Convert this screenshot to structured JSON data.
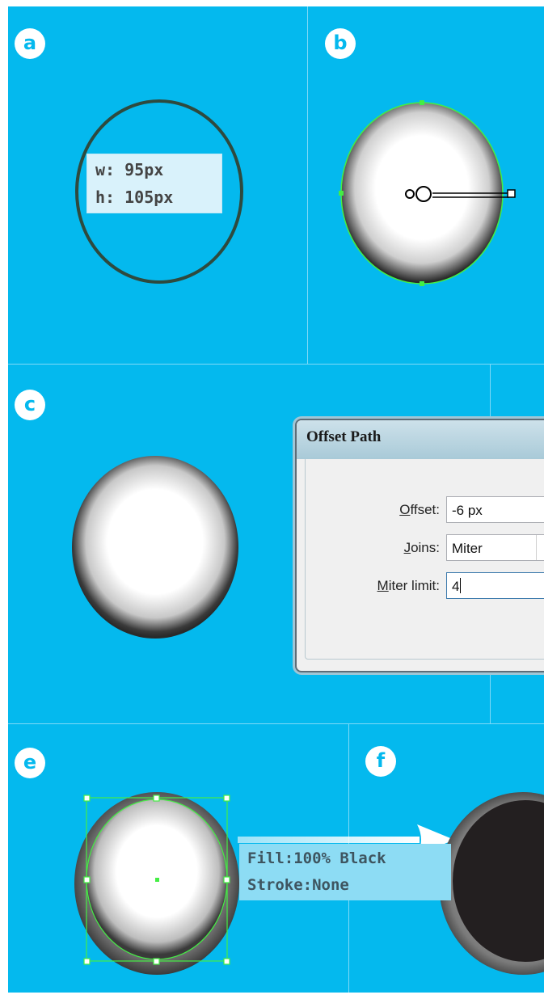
{
  "colors": {
    "background": "#04b9ee",
    "panel_lines": "#7fd9f7",
    "selection_green": "#44ee44",
    "ellipse_stroke": "#2e4a3e"
  },
  "steps": {
    "a": {
      "badge": "a",
      "width_label": "w: 95px",
      "height_label": "h: 105px"
    },
    "b": {
      "badge": "b"
    },
    "c": {
      "badge": "c"
    },
    "e": {
      "badge": "e"
    },
    "f": {
      "badge": "f"
    }
  },
  "dialog": {
    "title": "Offset Path",
    "offset": {
      "label_underlined": "O",
      "label_rest": "ffset:",
      "value": "-6 px"
    },
    "joins": {
      "label_underlined": "J",
      "label_rest": "oins:",
      "value": "Miter",
      "dropdown_icon": "chevron-down-icon"
    },
    "miter_limit": {
      "label_underlined": "M",
      "label_rest": "iter limit:",
      "value": "4"
    }
  },
  "fill_info": {
    "fill_label": "Fill:100% Black",
    "stroke_label": "Stroke:None"
  }
}
